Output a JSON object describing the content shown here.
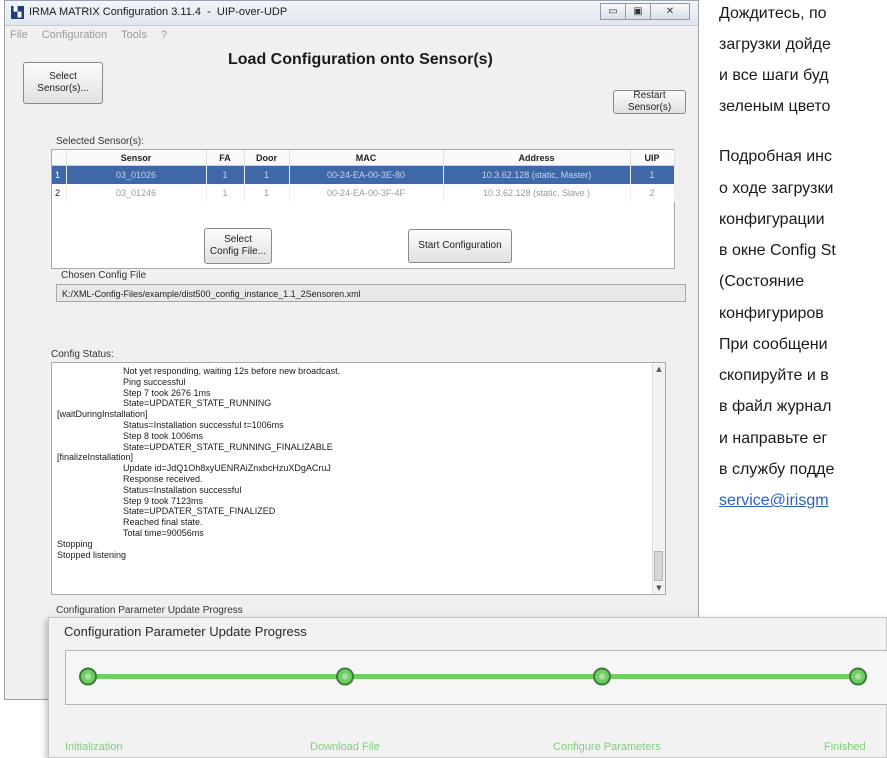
{
  "window": {
    "title": "IRMA MATRIX Configuration 3.11.4  -  UIP-over-UDP",
    "app_icon": "app-icon",
    "controls": [
      "minimize-icon",
      "maximize-icon",
      "close-icon"
    ]
  },
  "menu": [
    "File",
    "Configuration",
    "Tools",
    "?"
  ],
  "toolbar": {
    "select_sensors": "Select Sensor(s)...",
    "heading": "Load Configuration onto Sensor(s)",
    "restart_sensor": "Restart Sensor(s)"
  },
  "sensors": {
    "group_label": "Selected Sensor(s):",
    "columns": [
      "",
      "Sensor",
      "FA",
      "Door",
      "MAC",
      "Address",
      "UIP"
    ],
    "rows": [
      {
        "index": "1",
        "sensor": "03_01026",
        "fa": "1",
        "door": "1",
        "mac": "00-24-EA-00-3E-80",
        "address": "10.3.62.128 (static, Master)",
        "uip": "1",
        "selected": true
      },
      {
        "index": "2",
        "sensor": "03_01246",
        "fa": "1",
        "door": "1",
        "mac": "00-24-EA-00-3F-4F",
        "address": "10.3.62.128 (static,  Slave )",
        "uip": "2",
        "selected": false
      }
    ]
  },
  "config": {
    "select_config_line1": "Select",
    "select_config_line2": "Config File...",
    "start_configuration": "Start Configuration",
    "chosen_label": "Chosen Config File",
    "chosen_value": "K:/XML-Config-Files/example/dist500_config_instance_1.1_2Sensoren.xml"
  },
  "status": {
    "label": "Config Status:",
    "lines": [
      {
        "indent": true,
        "text": "Not yet responding, waiting 12s before new broadcast."
      },
      {
        "indent": true,
        "text": "Ping successful"
      },
      {
        "indent": true,
        "text": "Step 7 took 2676 1ms"
      },
      {
        "indent": true,
        "text": "State=UPDATER_STATE_RUNNING"
      },
      {
        "indent": false,
        "text": "[waitDuringInstallation]"
      },
      {
        "indent": true,
        "text": "Status=Installation successful t=1006ms"
      },
      {
        "indent": true,
        "text": "Step 8 took 1006ms"
      },
      {
        "indent": true,
        "text": "State=UPDATER_STATE_RUNNING_FINALIZABLE"
      },
      {
        "indent": false,
        "text": "[finalizeInstallation]"
      },
      {
        "indent": true,
        "text": "Update id=JdQ1Oh8xyUENRAiZnxbcHzuXDgACruJ"
      },
      {
        "indent": true,
        "text": "Response received."
      },
      {
        "indent": true,
        "text": "Status=Installation successful"
      },
      {
        "indent": true,
        "text": "Step 9 took 7123ms"
      },
      {
        "indent": true,
        "text": "State=UPDATER_STATE_FINALIZED"
      },
      {
        "indent": true,
        "text": "Reached final state."
      },
      {
        "indent": true,
        "text": "Total time=90056ms"
      },
      {
        "indent": false,
        "text": "Stopping"
      },
      {
        "indent": false,
        "text": "Stopped listening"
      }
    ]
  },
  "progress": {
    "label": "Configuration Parameter Update Progress",
    "stages": [
      "Initialization",
      "Download File",
      "Configure Parameters",
      "Finished"
    ],
    "completed_fraction": 1.0,
    "color": "#6fcf63"
  },
  "doc_text": {
    "lines": [
      "Дождитесь, по",
      "загрузки дойде",
      "и все шаги буд",
      "зеленым цвето",
      "Подробная инс",
      "о ходе загрузки",
      "конфигурации",
      "в окне Config St",
      "(Состояние",
      "конфигуриров",
      "При сообщени",
      "скопируйте и в",
      "в файл журнал",
      "и направьте ег",
      "в службу подде"
    ],
    "link": "service@irisgm"
  }
}
